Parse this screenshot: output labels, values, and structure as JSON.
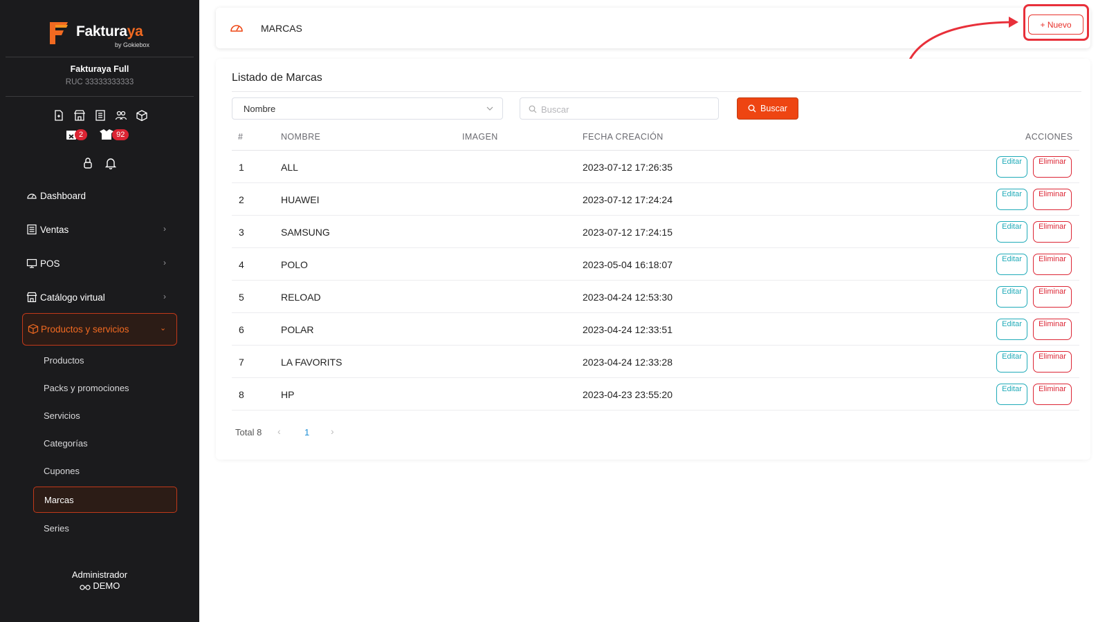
{
  "sidebar": {
    "brand": {
      "name_main": "Faktura",
      "name_accent": "ya",
      "sub": "by Gokiebox"
    },
    "company": {
      "name": "Fakturaya Full",
      "ruc": "RUC 33333333333"
    },
    "badges": {
      "calendar_count": "2",
      "box_count": "92"
    },
    "nav": [
      {
        "label": "Dashboard",
        "icon": "gauge-icon"
      },
      {
        "label": "Ventas",
        "icon": "receipt-icon"
      },
      {
        "label": "POS",
        "icon": "monitor-icon"
      },
      {
        "label": "Catálogo virtual",
        "icon": "store-icon"
      }
    ],
    "active_nav": {
      "label": "Productos y servicios",
      "icon": "box-icon"
    },
    "sub_items": [
      "Productos",
      "Packs y promociones",
      "Servicios",
      "Categorías",
      "Cupones",
      "Marcas",
      "Series"
    ],
    "active_sub": "Marcas",
    "user": {
      "role": "Administrador",
      "name": "DEMO"
    }
  },
  "header": {
    "title": "MARCAS",
    "new_button": "+ Nuevo"
  },
  "list": {
    "title": "Listado de Marcas",
    "filter_select": "Nombre",
    "search_placeholder": "Buscar",
    "search_button": "Buscar",
    "columns": [
      "#",
      "NOMBRE",
      "IMAGEN",
      "FECHA CREACIÓN",
      "ACCIONES"
    ],
    "rows": [
      {
        "num": "1",
        "name": "ALL",
        "date": "2023-07-12 17:26:35"
      },
      {
        "num": "2",
        "name": "HUAWEI",
        "date": "2023-07-12 17:24:24"
      },
      {
        "num": "3",
        "name": "SAMSUNG",
        "date": "2023-07-12 17:24:15"
      },
      {
        "num": "4",
        "name": "POLO",
        "date": "2023-05-04 16:18:07"
      },
      {
        "num": "5",
        "name": "RELOAD",
        "date": "2023-04-24 12:53:30"
      },
      {
        "num": "6",
        "name": "POLAR",
        "date": "2023-04-24 12:33:51"
      },
      {
        "num": "7",
        "name": "LA FAVORITS",
        "date": "2023-04-24 12:33:28"
      },
      {
        "num": "8",
        "name": "HP",
        "date": "2023-04-23 23:55:20"
      }
    ],
    "edit_label": "Editar",
    "delete_label": "Eliminar",
    "pagination": {
      "total": "Total 8",
      "current_page": "1"
    }
  },
  "colors": {
    "accent": "#ee4512",
    "sidebar_bg": "#1b1b1d",
    "edit": "#1eaab8",
    "delete": "#dc2433",
    "annotation": "#e8303a"
  }
}
